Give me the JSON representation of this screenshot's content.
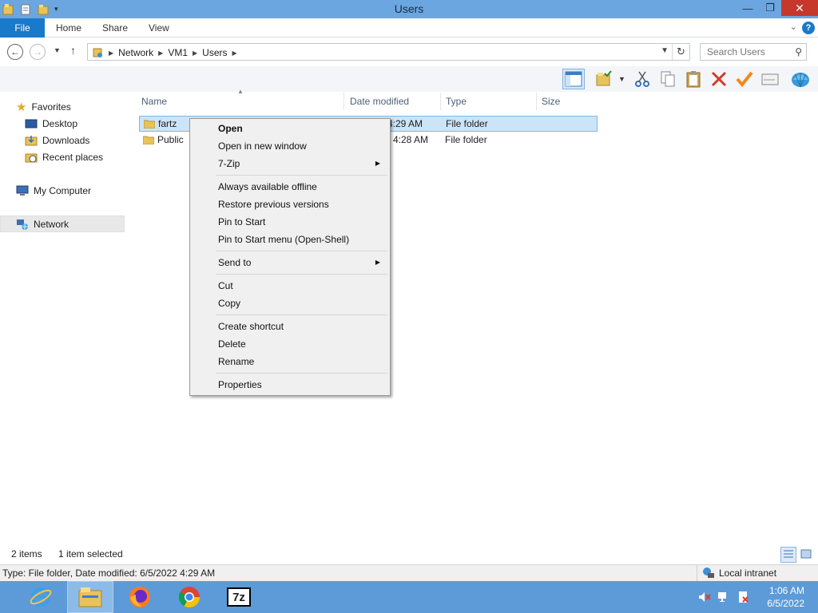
{
  "window": {
    "title": "Users",
    "minimize": "—",
    "restore": "❐",
    "close": "✕"
  },
  "ribbon": {
    "tabs": [
      "File",
      "Home",
      "Share",
      "View"
    ],
    "help": "?",
    "collapse": "⌄"
  },
  "address": {
    "crumbs": [
      "Network",
      "VM1",
      "Users"
    ],
    "search_placeholder": "Search Users"
  },
  "nav": {
    "favorites": "Favorites",
    "desktop": "Desktop",
    "downloads": "Downloads",
    "recent": "Recent places",
    "computer": "My Computer",
    "network": "Network"
  },
  "columns": {
    "name": "Name",
    "date": "Date modified",
    "type": "Type",
    "size": "Size"
  },
  "files": [
    {
      "name": "fartz",
      "date": "4:29 AM",
      "type": "File folder"
    },
    {
      "name": "Public",
      "date": "4:28 AM",
      "type": "File folder"
    }
  ],
  "context_menu": {
    "open": "Open",
    "open_new_window": "Open in new window",
    "sevenzip": "7-Zip",
    "offline": "Always available offline",
    "restore": "Restore previous versions",
    "pin_start": "Pin to Start",
    "pin_start_menu": "Pin to Start menu (Open-Shell)",
    "send_to": "Send to",
    "cut": "Cut",
    "copy": "Copy",
    "create_shortcut": "Create shortcut",
    "delete": "Delete",
    "rename": "Rename",
    "properties": "Properties"
  },
  "status": {
    "items": "2 items",
    "selected": "1 item selected",
    "details": "Type: File folder, Date modified: 6/5/2022 4:29 AM",
    "zone": "Local intranet"
  },
  "taskbar": {
    "time": "1:06 AM",
    "date": "6/5/2022",
    "sevenzip_label": "7z"
  },
  "colors": {
    "titlebar": "#6ba6e0",
    "file_tab": "#1979ca",
    "close": "#c7382c",
    "selection": "#cce4f7",
    "taskbar": "#5c9bd8"
  }
}
